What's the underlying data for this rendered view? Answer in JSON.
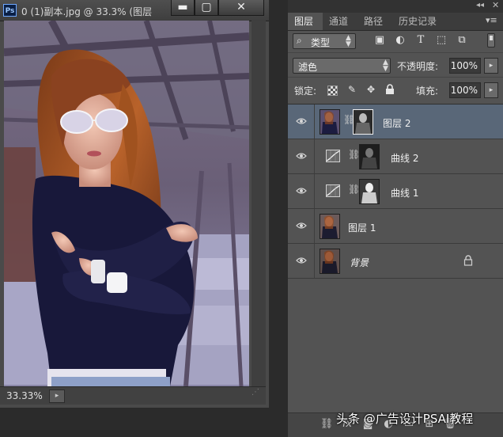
{
  "document": {
    "title": "0 (1)副本.jpg @ 33.3% (图层",
    "zoom": "33.33%",
    "window_buttons": {
      "minimize": "▬",
      "maximize": "▢",
      "close": "✕"
    },
    "app_logo": "Ps"
  },
  "panel": {
    "tabs": [
      {
        "label": "图层",
        "active": true
      },
      {
        "label": "通道",
        "active": false
      },
      {
        "label": "路径",
        "active": false
      },
      {
        "label": "历史记录",
        "active": false
      }
    ],
    "filter": {
      "label": "类型",
      "icons": [
        "image-filter-icon",
        "adjustment-filter-icon",
        "type-filter-icon",
        "shape-filter-icon",
        "smart-object-filter-icon"
      ]
    },
    "blend_mode": "滤色",
    "opacity_label": "不透明度:",
    "opacity_value": "100%",
    "lock_label": "锁定:",
    "fill_label": "填充:",
    "fill_value": "100%",
    "layers": [
      {
        "name": "图层 2",
        "kind": "pixel-with-mask",
        "selected": true,
        "italic": false,
        "locked": false
      },
      {
        "name": "曲线 2",
        "kind": "curves",
        "selected": false,
        "italic": false,
        "locked": false
      },
      {
        "name": "曲线 1",
        "kind": "curves",
        "selected": false,
        "italic": false,
        "locked": false
      },
      {
        "name": "图层 1",
        "kind": "pixel",
        "selected": false,
        "italic": false,
        "locked": false
      },
      {
        "name": "背景",
        "kind": "background",
        "selected": false,
        "italic": true,
        "locked": true
      }
    ]
  },
  "watermark": "头条 @广告设计PSAI教程",
  "colors": {
    "selected_row": "#596778",
    "panel_bg": "#535353",
    "app_bg": "#2b2b2b"
  }
}
